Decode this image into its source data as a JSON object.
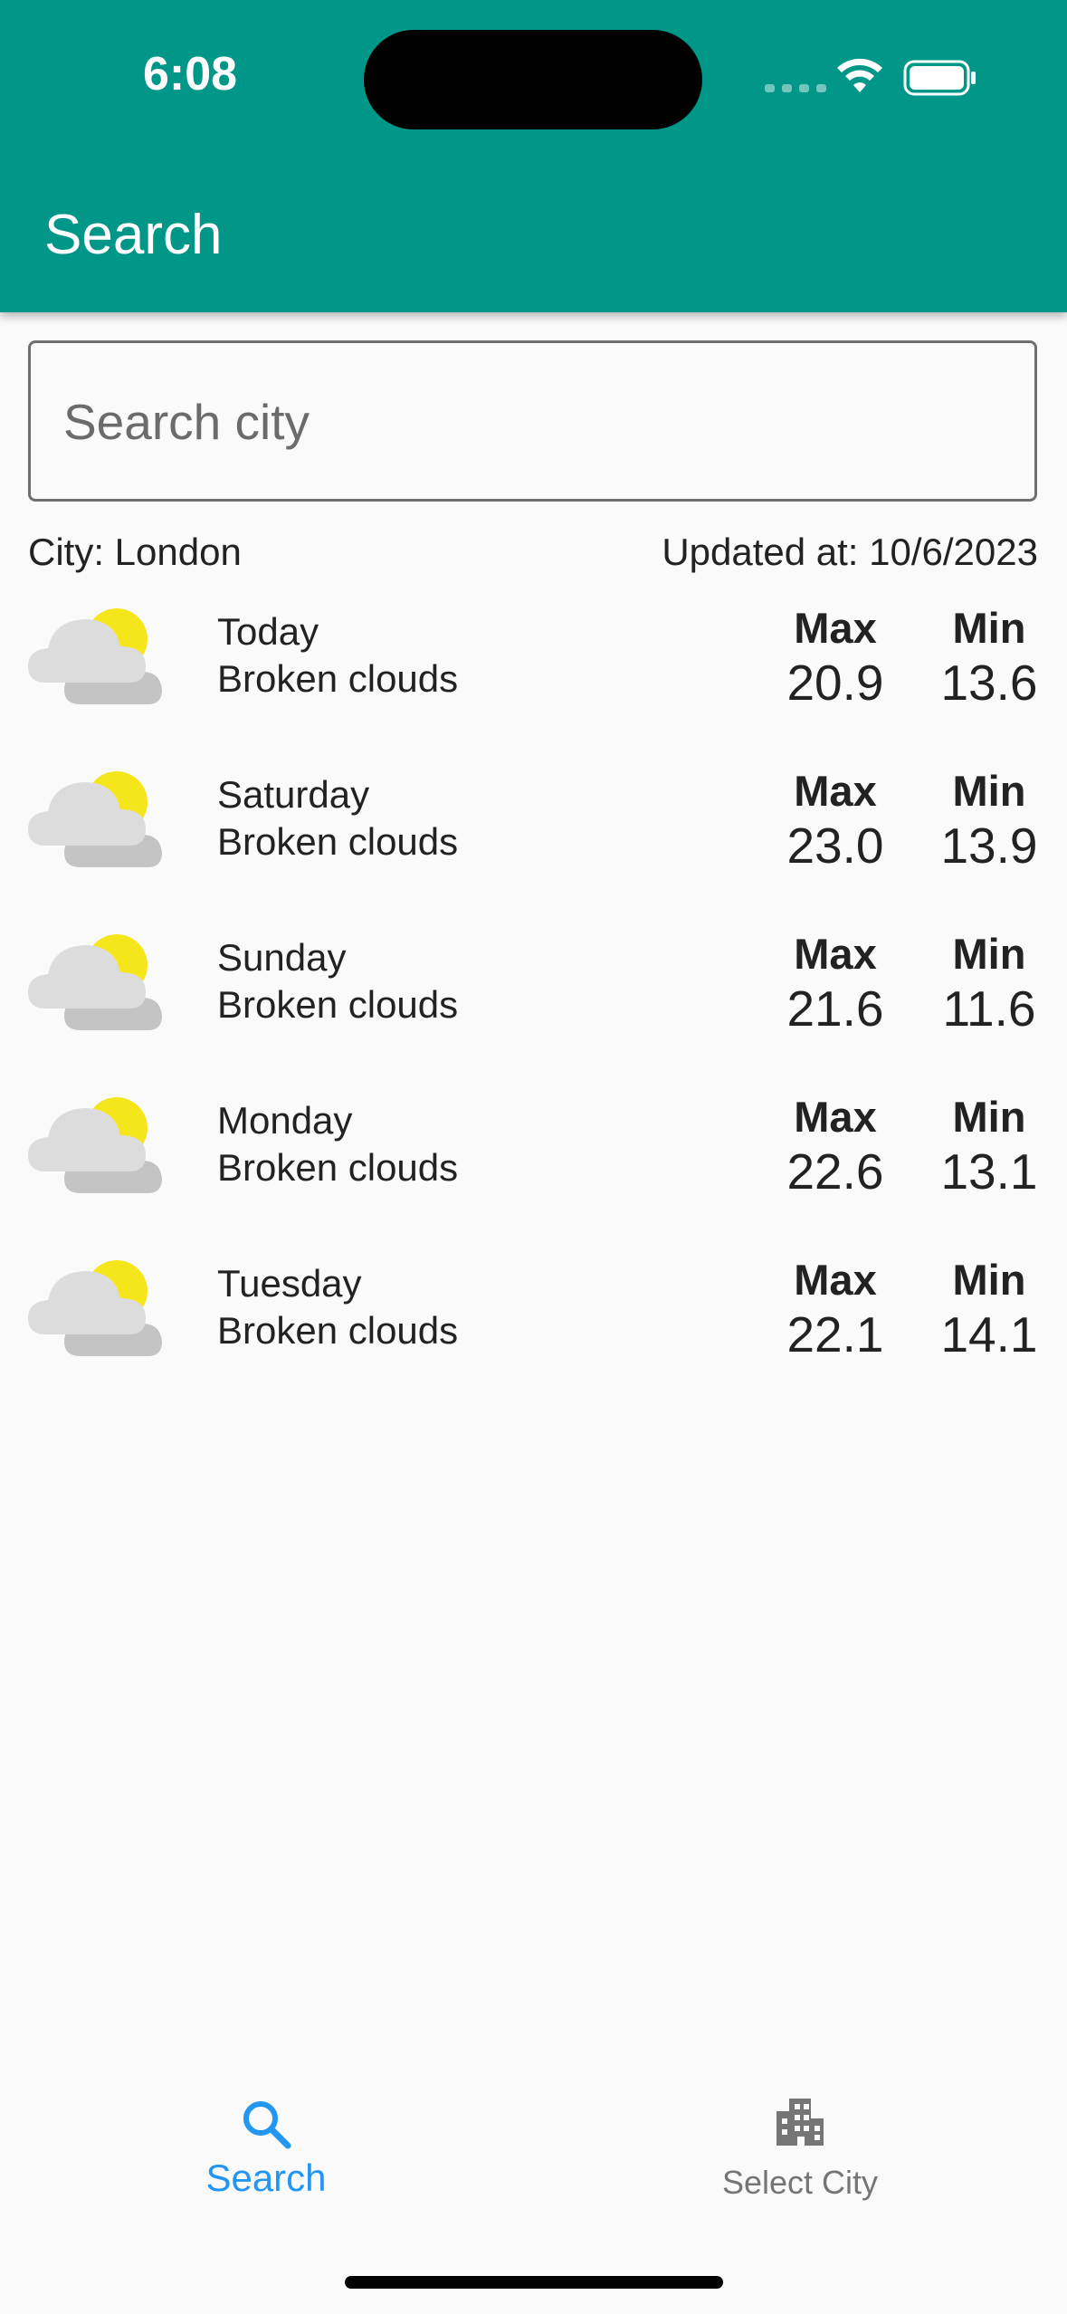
{
  "status_bar": {
    "time": "6:08"
  },
  "app_bar": {
    "title": "Search"
  },
  "search": {
    "placeholder": "Search city",
    "value": ""
  },
  "meta": {
    "city": "City: London",
    "updated": "Updated at: 10/6/2023"
  },
  "forecast": {
    "max_label": "Max",
    "min_label": "Min",
    "days": [
      {
        "day": "Today",
        "description": "Broken clouds",
        "max": "20.9",
        "min": "13.6",
        "icon": "broken-clouds-icon"
      },
      {
        "day": "Saturday",
        "description": "Broken clouds",
        "max": "23.0",
        "min": "13.9",
        "icon": "broken-clouds-icon"
      },
      {
        "day": "Sunday",
        "description": "Broken clouds",
        "max": "21.6",
        "min": "11.6",
        "icon": "broken-clouds-icon"
      },
      {
        "day": "Monday",
        "description": "Broken clouds",
        "max": "22.6",
        "min": "13.1",
        "icon": "broken-clouds-icon"
      },
      {
        "day": "Tuesday",
        "description": "Broken clouds",
        "max": "22.1",
        "min": "14.1",
        "icon": "broken-clouds-icon"
      }
    ]
  },
  "bottom_nav": {
    "items": [
      {
        "label": "Search",
        "icon": "search-icon",
        "active": true
      },
      {
        "label": "Select City",
        "icon": "city-icon",
        "active": false
      }
    ]
  },
  "colors": {
    "app_bar": "#009688",
    "active_tab": "#2196f3",
    "inactive_tab": "#757575",
    "background": "#fafafa"
  }
}
